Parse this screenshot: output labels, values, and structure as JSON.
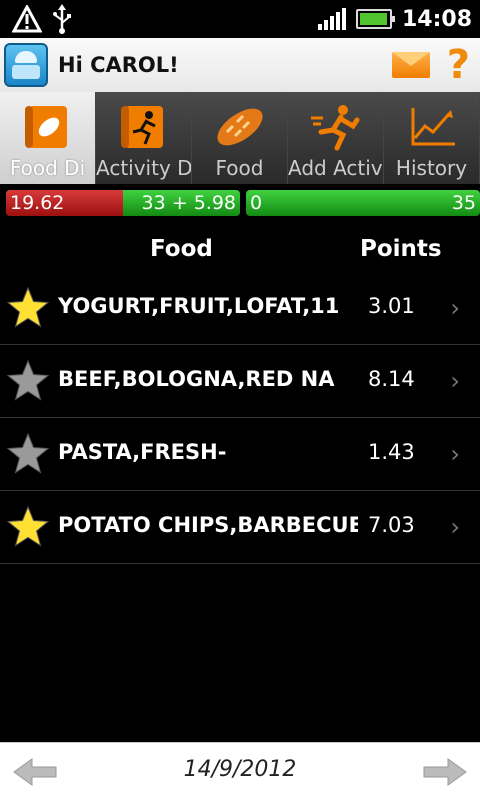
{
  "status_bar": {
    "time": "14:08",
    "icons": [
      "warning-icon",
      "usb-icon",
      "signal-icon",
      "battery-icon"
    ]
  },
  "title_bar": {
    "greeting": "Hi CAROL!",
    "icons": [
      "scale-app-icon",
      "mail-icon",
      "help-icon"
    ]
  },
  "tabs": [
    {
      "label": "Food Di",
      "icon": "food-diary-icon",
      "active": true
    },
    {
      "label": "Activity Di",
      "icon": "activity-diary-icon",
      "active": false
    },
    {
      "label": "Food",
      "icon": "bread-icon",
      "active": false
    },
    {
      "label": "Add Activi",
      "icon": "runner-icon",
      "active": false
    },
    {
      "label": "History",
      "icon": "chart-icon",
      "active": false
    }
  ],
  "budget_bar": {
    "left_value": "19.62",
    "right_value": "33 + 5.98",
    "consumed_fraction": 0.5
  },
  "activity_bar": {
    "left_value": "0",
    "right_value": "35"
  },
  "list_header": {
    "food": "Food",
    "points": "Points"
  },
  "foods": [
    {
      "name": "YOGURT,FRUIT,LOFAT,11",
      "points": "3.01",
      "favorite": true
    },
    {
      "name": "BEEF,BOLOGNA,RED NA",
      "points": "8.14",
      "favorite": false
    },
    {
      "name": "PASTA,FRESH-",
      "points": "1.43",
      "favorite": false
    },
    {
      "name": "POTATO CHIPS,BARBECUE-",
      "points": "7.03",
      "favorite": true
    }
  ],
  "chevron": "›",
  "footer": {
    "date": "14/9/2012"
  },
  "colors": {
    "star_favorite": "#ffe033",
    "star_normal": "#9a9a9a",
    "accent_orange": "#f07d00"
  }
}
